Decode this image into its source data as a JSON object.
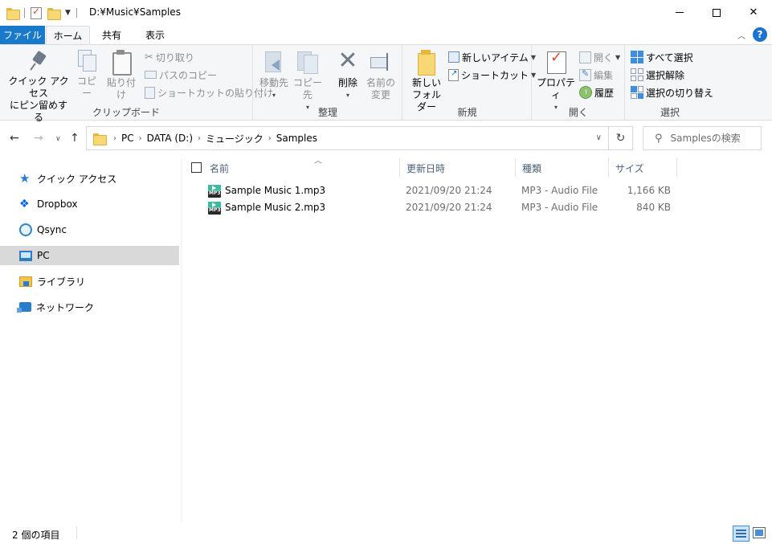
{
  "window": {
    "title": "D:¥Music¥Samples"
  },
  "tabs": {
    "file": "ファイル",
    "home": "ホーム",
    "share": "共有",
    "view": "表示"
  },
  "ribbon": {
    "clipboard": {
      "label": "クリップボード",
      "pin_line1": "クイック アクセス",
      "pin_line2": "にピン留めする",
      "copy": "コピー",
      "paste": "貼り付け",
      "cut": "切り取り",
      "copy_path": "パスのコピー",
      "paste_shortcut": "ショートカットの貼り付け"
    },
    "organize": {
      "label": "整理",
      "move_to": "移動先",
      "copy_to": "コピー先",
      "delete": "削除",
      "rename_line1": "名前の",
      "rename_line2": "変更"
    },
    "new": {
      "label": "新規",
      "new_folder_line1": "新しい",
      "new_folder_line2": "フォルダー",
      "new_item": "新しいアイテム",
      "easy_access": "ショートカット"
    },
    "open": {
      "label": "開く",
      "properties": "プロパティ",
      "open": "開く",
      "edit": "編集",
      "history": "履歴"
    },
    "select": {
      "label": "選択",
      "select_all": "すべて選択",
      "select_none": "選択解除",
      "invert": "選択の切り替え"
    }
  },
  "address": {
    "crumbs": [
      "PC",
      "DATA (D:)",
      "ミュージック",
      "Samples"
    ]
  },
  "search": {
    "placeholder": "Samplesの検索"
  },
  "nav": {
    "items": [
      {
        "label": "クイック アクセス",
        "icon": "star-icon"
      },
      {
        "label": "Dropbox",
        "icon": "dropbox-icon"
      },
      {
        "label": "Qsync",
        "icon": "qsync-icon"
      },
      {
        "label": "PC",
        "icon": "pc-icon",
        "selected": true
      },
      {
        "label": "ライブラリ",
        "icon": "library-icon"
      },
      {
        "label": "ネットワーク",
        "icon": "network-icon"
      }
    ]
  },
  "columns": {
    "name": "名前",
    "date": "更新日時",
    "type": "種類",
    "size": "サイズ"
  },
  "files": [
    {
      "name": "Sample Music 1.mp3",
      "date": "2021/09/20 21:24",
      "type": "MP3 - Audio File",
      "size": "1,166 KB",
      "icon": "mp3-file-icon"
    },
    {
      "name": "Sample Music 2.mp3",
      "date": "2021/09/20 21:24",
      "type": "MP3 - Audio File",
      "size": "840 KB",
      "icon": "mp3-file-icon"
    }
  ],
  "status": {
    "count": "2 個の項目"
  },
  "colors": {
    "file_tab": "#1979ca",
    "accent": "#3d8ee0"
  }
}
